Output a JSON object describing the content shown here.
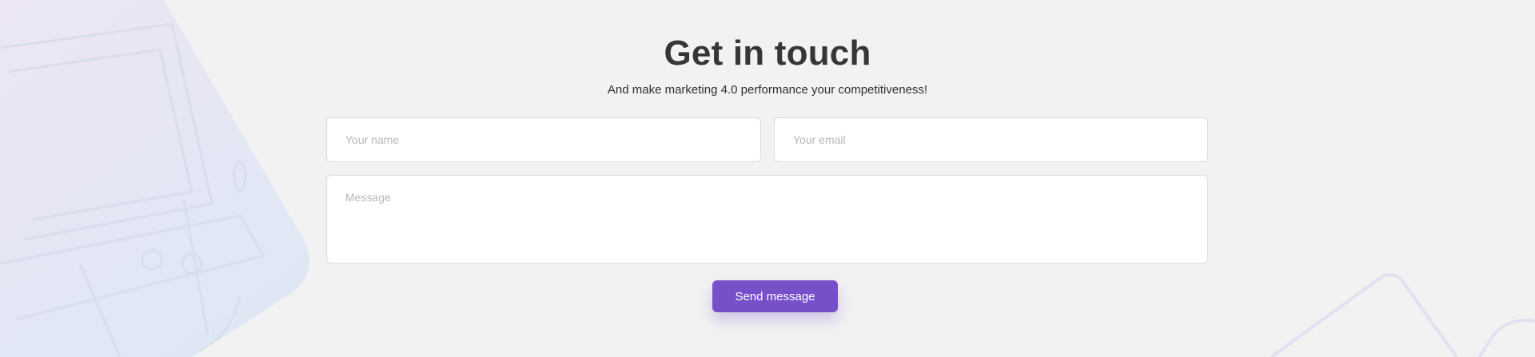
{
  "contact": {
    "title": "Get in touch",
    "subtitle": "And make marketing 4.0 performance your competitiveness!",
    "name_placeholder": "Your name",
    "email_placeholder": "Your email",
    "message_placeholder": "Message",
    "send_label": "Send message"
  },
  "colors": {
    "background": "#f2f2f2",
    "accent": "#7650c9",
    "title": "#363636",
    "placeholder": "#b7b7b7"
  },
  "decorations": {
    "left": "laptop-desk-photo",
    "right": "outline-shapes"
  }
}
